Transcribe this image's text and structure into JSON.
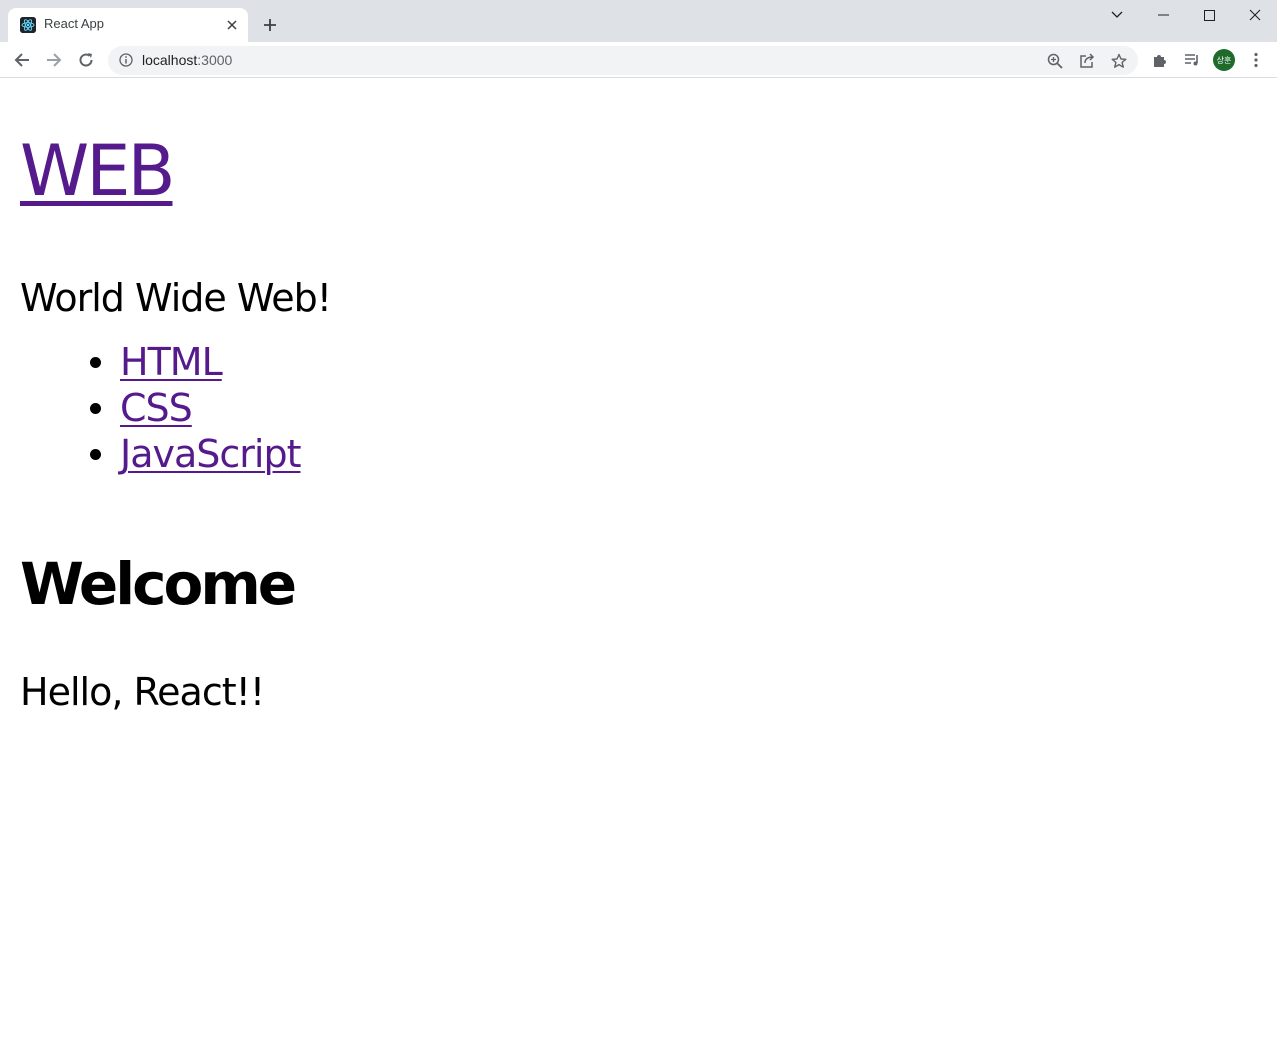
{
  "browser": {
    "tab": {
      "title": "React App",
      "favicon": "react-logo-icon"
    },
    "address_bar": {
      "host": "localhost",
      "port": ":3000"
    },
    "profile": {
      "avatar_text": "상훈",
      "avatar_color": "#1e6b2c"
    }
  },
  "page": {
    "site_title": "WEB",
    "site_subtitle": "World Wide Web!",
    "nav": {
      "items": [
        {
          "label": "HTML"
        },
        {
          "label": "CSS"
        },
        {
          "label": "JavaScript"
        }
      ]
    },
    "article": {
      "title": "Welcome",
      "body": "Hello, React!!"
    },
    "link_color": "#551a8b"
  }
}
